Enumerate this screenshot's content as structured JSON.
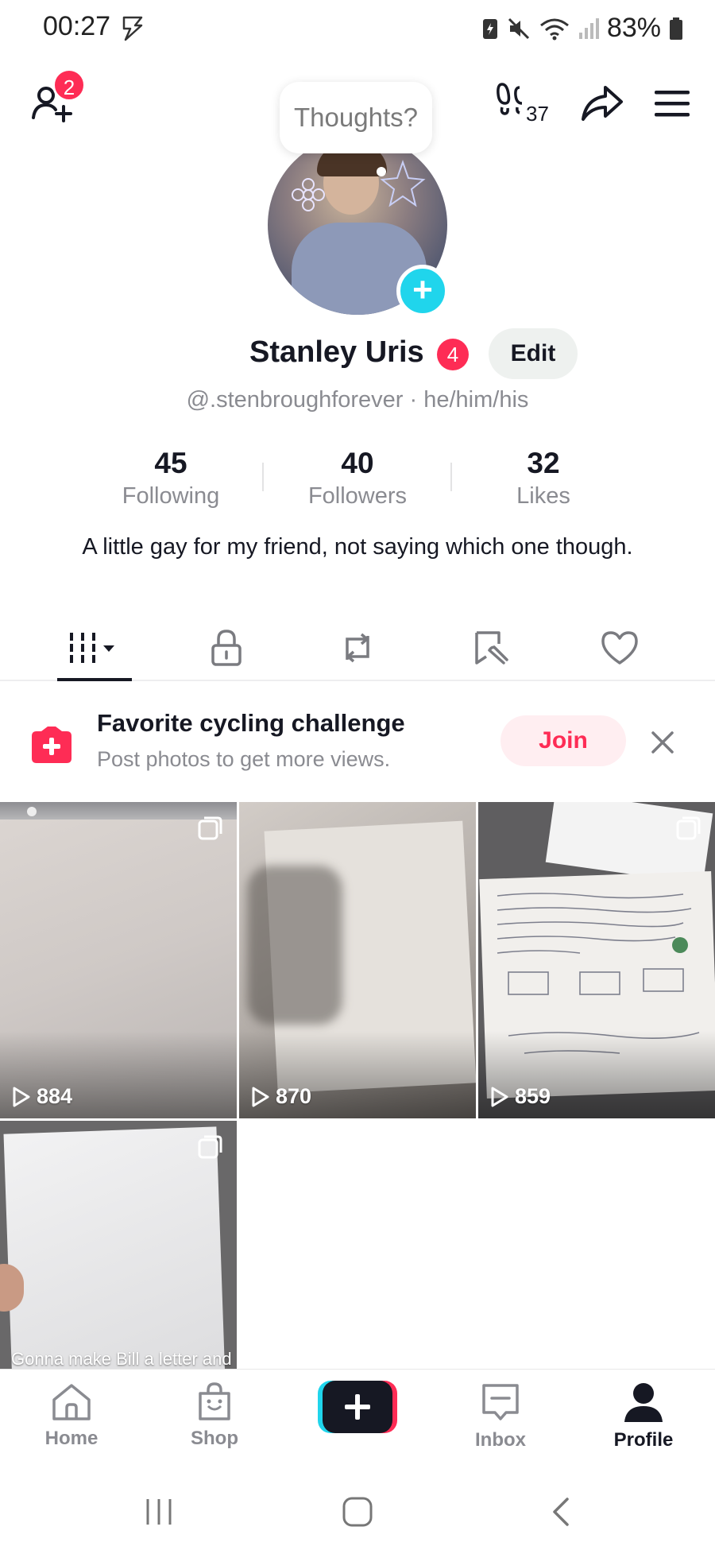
{
  "status_bar": {
    "time": "00:27",
    "battery_percent": "83%"
  },
  "top_nav": {
    "friend_requests_badge": "2",
    "profile_views_count": "37"
  },
  "thoughts_bubble": "Thoughts?",
  "profile": {
    "display_name": "Stanley Uris",
    "name_badge": "4",
    "edit_label": "Edit",
    "handle_line": "@.stenbroughforever · he/him/his",
    "stats": [
      {
        "value": "45",
        "label": "Following"
      },
      {
        "value": "40",
        "label": "Followers"
      },
      {
        "value": "32",
        "label": "Likes"
      }
    ],
    "bio": "A little gay for my friend, not saying which one though."
  },
  "tabs": [
    "videos-icon",
    "lock-icon",
    "repost-icon",
    "favorites-icon",
    "liked-icon"
  ],
  "challenge": {
    "title": "Favorite cycling challenge",
    "subtitle": "Post photos to get more views.",
    "join_label": "Join"
  },
  "videos": [
    {
      "views": "884"
    },
    {
      "views": "870"
    },
    {
      "views": "859"
    },
    {
      "caption": "Gonna make Bill a letter and"
    }
  ],
  "bottom_nav": {
    "home": "Home",
    "shop": "Shop",
    "inbox": "Inbox",
    "profile": "Profile"
  },
  "colors": {
    "accent_red": "#fe2c55",
    "accent_cyan": "#20d5ec",
    "text_primary": "#161823",
    "text_secondary": "#8a8b91"
  }
}
